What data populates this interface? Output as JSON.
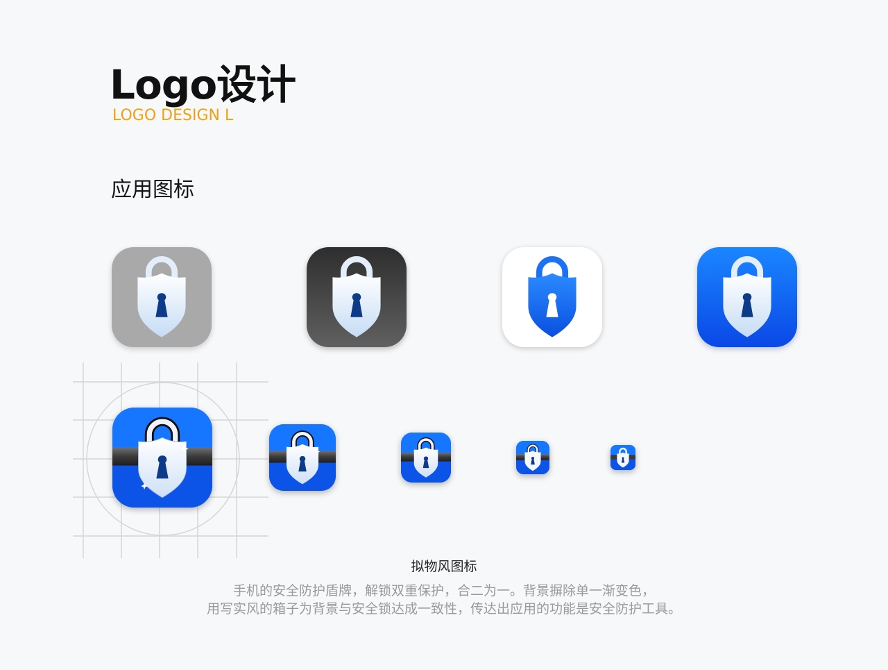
{
  "header": {
    "title": "Logo设计",
    "subtitle": "LOGO DESIGN L"
  },
  "section": {
    "title": "应用图标"
  },
  "icon_variants": [
    {
      "name": "gray-background-lock",
      "background": "#a9a9a9"
    },
    {
      "name": "dark-background-lock",
      "background": "#3a3a3a"
    },
    {
      "name": "white-background-blue-lock",
      "background": "#ffffff"
    },
    {
      "name": "blue-background-lock",
      "background": "#0a5ef0"
    }
  ],
  "skeuomorphic_sizes_count": 5,
  "caption": {
    "title": "拟物风图标",
    "line1": "手机的安全防护盾牌，解锁双重保护，合二为一。背景摒除单一渐变色，",
    "line2": "用写实风的箱子为背景与安全锁达成一致性，传达出应用的功能是安全防护工具。"
  },
  "colors": {
    "accent": "#f0a113",
    "brand_blue": "#0a5ef0",
    "text_dark": "#111111",
    "text_muted": "#9a9a9a",
    "keyhole": "#0e3a8a"
  },
  "icons": {
    "lock": "lock-shield-icon",
    "keyhole": "keyhole-icon"
  }
}
